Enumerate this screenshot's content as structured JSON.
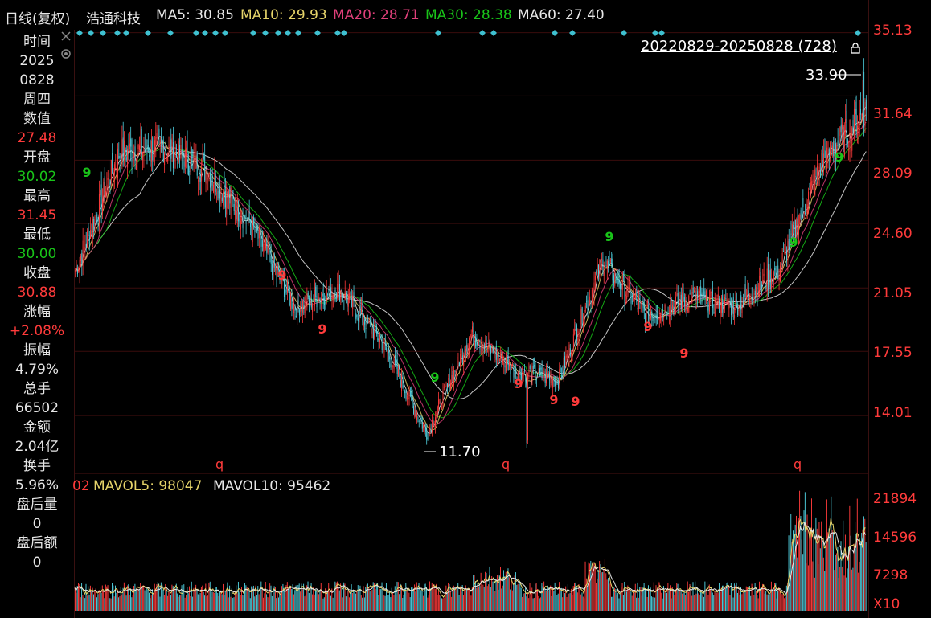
{
  "header": {
    "chart_type": "日线(复权)",
    "stock_name": "浩通科技",
    "ma": [
      {
        "label": "MA5: 30.85",
        "color": "#e6e6e6"
      },
      {
        "label": "MA10: 29.93",
        "color": "#e6d46a"
      },
      {
        "label": "MA20: 28.71",
        "color": "#e0407a"
      },
      {
        "label": "MA30: 28.38",
        "color": "#19c419"
      },
      {
        "label": "MA60: 27.40",
        "color": "#e6e6e6"
      }
    ]
  },
  "sidebar": {
    "time_label": "时间",
    "date_year": "2025",
    "date_md": "0828",
    "weekday": "周四",
    "value_label": "数值",
    "value": "27.48",
    "open_label": "开盘",
    "open": "30.02",
    "high_label": "最高",
    "high": "31.45",
    "low_label": "最低",
    "low": "30.00",
    "close_label": "收盘",
    "close": "30.88",
    "change_label": "涨幅",
    "change": "+2.08%",
    "amplitude_label": "振幅",
    "amplitude": "4.79%",
    "volume_label": "总手",
    "volume": "66502",
    "amount_label": "金额",
    "amount": "2.04亿",
    "turnover_label": "换手",
    "turnover": "5.96%",
    "after_vol_label": "盘后量",
    "after_vol": "0",
    "after_amt_label": "盘后额",
    "after_amt": "0"
  },
  "price_axis": [
    "35.13",
    "31.64",
    "28.09",
    "24.60",
    "21.05",
    "17.55",
    "14.01"
  ],
  "volume_axis": [
    "21894",
    "14596",
    "7298",
    "X10"
  ],
  "range_label": "20220829-20250828 (728)",
  "annotations": {
    "max_label": "33.90",
    "min_label": "11.70"
  },
  "volume_legend": {
    "prefix": "02",
    "mavol5": "MAVOL5: 98047",
    "mavol10": "MAVOL10: 95462"
  },
  "markers": {
    "q_label": "q",
    "td_nine": "9",
    "colors": {
      "up": "#ff3b3b",
      "down": "#19c419",
      "signal": "#d040e0",
      "diamond": "#3fc0d0"
    }
  },
  "chart_data": {
    "type": "candlestick",
    "x_range": [
      "20220829",
      "20250828"
    ],
    "bar_count": 728,
    "y_price_range": [
      11.7,
      35.13
    ],
    "price_ticks": [
      35.13,
      31.64,
      28.09,
      24.6,
      21.05,
      17.55,
      14.01
    ],
    "highest": 33.9,
    "lowest": 11.7,
    "close_path_estimate": [
      {
        "t": "2022-08",
        "price": 22.0
      },
      {
        "t": "2022-11",
        "price": 28.5
      },
      {
        "t": "2023-01",
        "price": 28.8
      },
      {
        "t": "2023-03",
        "price": 27.5
      },
      {
        "t": "2023-06",
        "price": 24.5
      },
      {
        "t": "2023-08",
        "price": 20.0
      },
      {
        "t": "2023-10",
        "price": 21.0
      },
      {
        "t": "2024-01",
        "price": 18.0
      },
      {
        "t": "2024-02",
        "price": 13.0
      },
      {
        "t": "2024-04",
        "price": 18.5
      },
      {
        "t": "2024-07",
        "price": 16.5
      },
      {
        "t": "2024-09",
        "price": 16.0
      },
      {
        "t": "2024-10",
        "price": 22.5
      },
      {
        "t": "2024-12",
        "price": 19.5
      },
      {
        "t": "2025-02",
        "price": 20.5
      },
      {
        "t": "2025-04",
        "price": 20.0
      },
      {
        "t": "2025-06",
        "price": 22.0
      },
      {
        "t": "2025-07",
        "price": 28.0
      },
      {
        "t": "2025-08",
        "price": 30.88
      }
    ],
    "volume_ticks": [
      21894,
      14596,
      7298
    ],
    "volume_unit": "X10",
    "mavol5": 98047,
    "mavol10": 95462
  }
}
